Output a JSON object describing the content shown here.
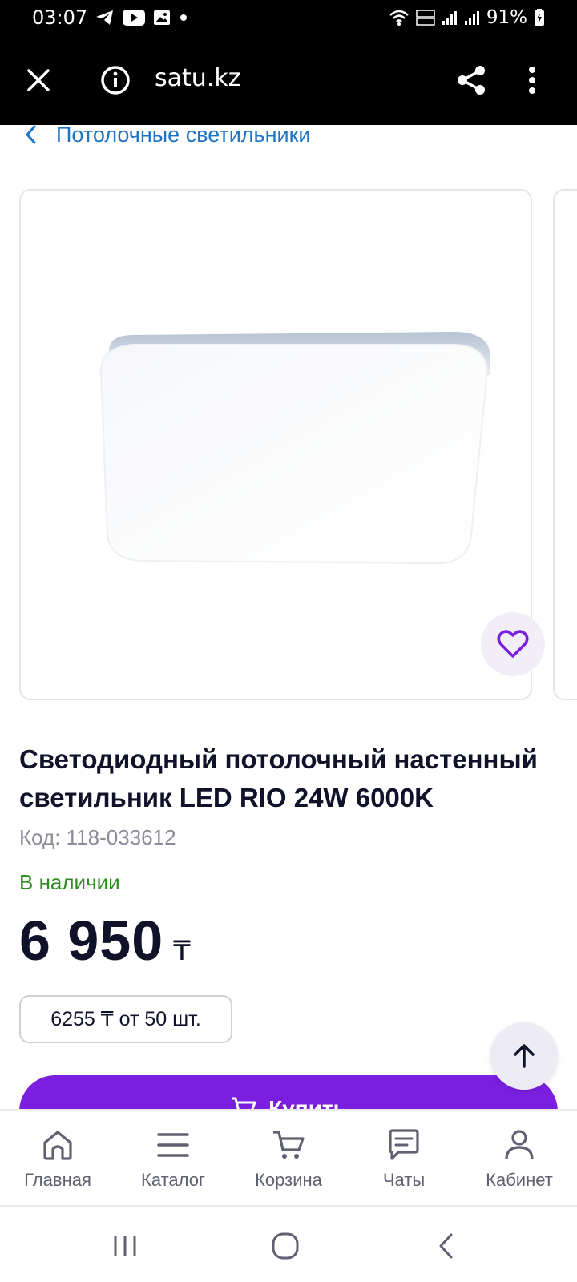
{
  "status_bar": {
    "time": "03:07",
    "battery": "91%"
  },
  "browser": {
    "url": "satu.kz"
  },
  "breadcrumb": {
    "label": "Потолочные светильники"
  },
  "product": {
    "title": "Светодиодный потолочный настенный светильник LED RIO 24W 6000K",
    "code_label": "Код:",
    "code_value": "118-033612",
    "stock": "В наличии",
    "price": "6 950",
    "currency": "₸",
    "wholesale": "6255 ₸ от 50 шт.",
    "buy_label": "Купить"
  },
  "bottom_nav": {
    "items": [
      {
        "label": "Главная"
      },
      {
        "label": "Каталог"
      },
      {
        "label": "Корзина"
      },
      {
        "label": "Чаты"
      },
      {
        "label": "Кабинет"
      }
    ]
  },
  "colors": {
    "accent": "#7a1fe0",
    "link": "#1c74c8",
    "in_stock": "#2e8b1e"
  }
}
